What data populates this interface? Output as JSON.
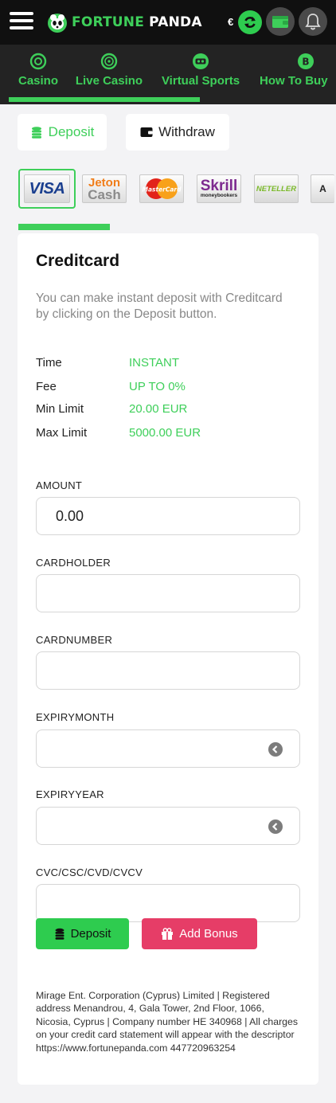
{
  "header": {
    "logo_part1": "FORTUNE",
    "logo_part2": "PANDA",
    "currency_symbol": "€",
    "accent_color": "#3ecf5a"
  },
  "category_nav": {
    "items": [
      {
        "label": "Casino",
        "icon": "chip-icon"
      },
      {
        "label": "Live Casino",
        "icon": "roulette-icon"
      },
      {
        "label": "Virtual Sports",
        "icon": "vr-headset-icon"
      },
      {
        "label": "How To Buy",
        "icon": "bitcoin-icon"
      }
    ]
  },
  "tabs": {
    "deposit_label": "Deposit",
    "withdraw_label": "Withdraw"
  },
  "payment_methods": [
    {
      "name": "VISA",
      "selected": true
    },
    {
      "name": "Jeton Cash",
      "selected": false
    },
    {
      "name": "MasterCard",
      "selected": false
    },
    {
      "name": "Skrill",
      "selected": false
    },
    {
      "name": "NETELLER",
      "selected": false
    },
    {
      "name": "A",
      "selected": false
    }
  ],
  "payment_labels": {
    "visa": "VISA",
    "jeton1": "Jeton",
    "jeton2": "Cash",
    "mastercard": "MasterCard",
    "skrill": "Skrill",
    "skrill_sub": "moneybookers",
    "neteller": "NETELLER",
    "partial": "A"
  },
  "card": {
    "title": "Creditcard",
    "description": "You can make instant deposit with Creditcard by clicking on the Deposit button.",
    "info": {
      "time_label": "Time",
      "time_value": "INSTANT",
      "fee_label": "Fee",
      "fee_value": "UP TO 0%",
      "min_label": "Min Limit",
      "min_value": "20.00 EUR",
      "max_label": "Max Limit",
      "max_value": "5000.00 EUR"
    },
    "form": {
      "amount_label": "AMOUNT",
      "amount_value": "0.00",
      "cardholder_label": "CARDHOLDER",
      "cardnumber_label": "CARDNUMBER",
      "expirymonth_label": "EXPIRYMONTH",
      "expiryyear_label": "EXPIRYYEAR",
      "cvc_label": "CVC/CSC/CVD/CVCV"
    },
    "deposit_button": "Deposit",
    "bonus_button": "Add Bonus",
    "legal": "Mirage Ent. Corporation (Cyprus) Limited | Registered address Menandrou, 4, Gala Tower, 2nd Floor, 1066, Nicosia, Cyprus | Company number HE 340968 | All charges on your credit card statement will appear with the descriptor https://www.fortunepanda.com 447720963254"
  }
}
